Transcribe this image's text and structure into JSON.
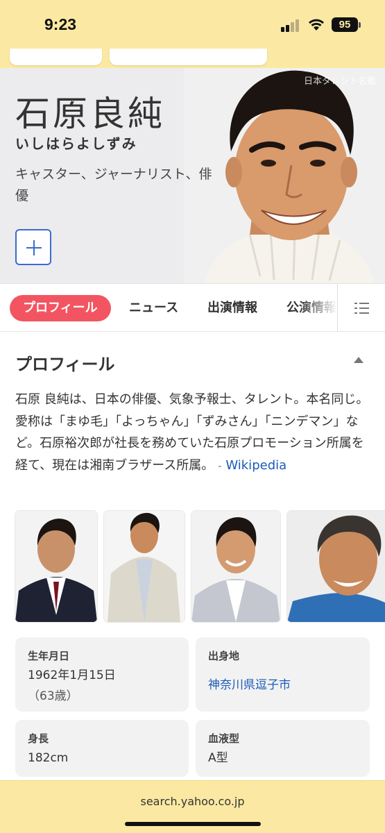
{
  "status_bar": {
    "time": "9:23",
    "battery": "95"
  },
  "top_strip": {
    "cards": [
      "",
      ""
    ]
  },
  "hero": {
    "name": "石原良純",
    "reading": "いしはらよしずみ",
    "description": "キャスター、ジャーナリスト、俳優",
    "image_credit": "日本タレント名鑑"
  },
  "tabs": [
    "プロフィール",
    "ニュース",
    "出演情報",
    "公演情報"
  ],
  "profile": {
    "title": "プロフィール",
    "text": "石原 良純は、日本の俳優、気象予報士、タレント。本名同じ。愛称は「まゆ毛」「よっちゃん」「ずみさん」「ニンデマン」など。石原裕次郎が社長を務めていた石原プロモーション所属を経て、現在は湘南ブラザース所属。",
    "source_sep": "-",
    "source_link": "Wikipedia"
  },
  "info": {
    "birth": {
      "label": "生年月日",
      "value": "1962年1月15日",
      "sub": "（63歳）"
    },
    "birthplace": {
      "label": "出身地",
      "value": "神奈川県逗子市"
    },
    "height": {
      "label": "身長",
      "value": "182cm"
    },
    "blood": {
      "label": "血液型",
      "value": "A型"
    }
  },
  "browser": {
    "url": "search.yahoo.co.jp"
  },
  "colors": {
    "accent_tab": "#f25561",
    "link": "#1a5bb7",
    "browser_bar": "#fbe9a3"
  }
}
